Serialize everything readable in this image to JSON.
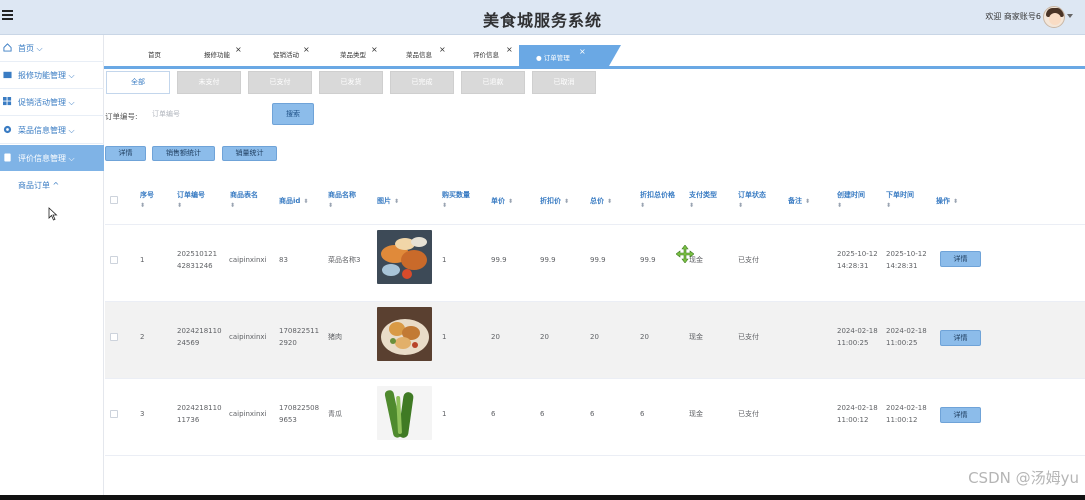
{
  "app": {
    "title": "美食城服务系统",
    "welcome": "欢迎 商家账号6"
  },
  "sidebar": {
    "items": [
      {
        "label": "首页",
        "icon": "home-icon"
      },
      {
        "label": "报修功能管理",
        "icon": "folder-icon"
      },
      {
        "label": "促销活动管理",
        "icon": "grid-icon"
      },
      {
        "label": "菜品信息管理",
        "icon": "gear-icon"
      },
      {
        "label": "评价信息管理",
        "icon": "doc-icon"
      }
    ],
    "sub_item": "商品订单",
    "active_index": 4
  },
  "tabs": {
    "items": [
      "首页",
      "报修功能",
      "促销活动",
      "菜品类型",
      "菜品信息",
      "评价信息"
    ],
    "active": "订单管理"
  },
  "status_tabs": [
    "全部",
    "未支付",
    "已支付",
    "已发货",
    "已完成",
    "已退款",
    "已取消"
  ],
  "search": {
    "label": "订单编号:",
    "placeholder": "订单编号",
    "button": "搜索"
  },
  "toolbar": {
    "detail": "详情",
    "sales_amount": "销售额统计",
    "sales_volume": "销量统计"
  },
  "table": {
    "headers": {
      "index": "序号",
      "order_no": "订单编号",
      "table_name": "商品表名",
      "goods_id": "商品id",
      "goods_name": "商品名称",
      "image": "图片",
      "qty": "购买数量",
      "price": "单价",
      "discount_price": "折扣价",
      "total": "总价",
      "discount_total": "折扣总价格",
      "pay_type": "支付类型",
      "status": "订单状态",
      "remark": "备注",
      "created": "创建时间",
      "ordered": "下单时间",
      "action": "操作"
    },
    "rows": [
      {
        "index": "1",
        "order_no_a": "202510121",
        "order_no_b": "42831246",
        "table_name": "caipinxinxi",
        "goods_id_a": "83",
        "goods_id_b": "",
        "goods_name": "菜品名称3",
        "qty": "1",
        "price": "99.9",
        "discount_price": "99.9",
        "total": "99.9",
        "discount_total": "99.9",
        "pay_type": "现金",
        "status": "已支付",
        "remark": "",
        "created_date": "2025-10-12",
        "created_time": "14:28:31",
        "ordered_date": "2025-10-12",
        "ordered_time": "14:28:31",
        "action": "详情"
      },
      {
        "index": "2",
        "order_no_a": "2024218110",
        "order_no_b": "24569",
        "table_name": "caipinxinxi",
        "goods_id_a": "170822511",
        "goods_id_b": "2920",
        "goods_name": "猪肉",
        "qty": "1",
        "price": "20",
        "discount_price": "20",
        "total": "20",
        "discount_total": "20",
        "pay_type": "现金",
        "status": "已支付",
        "remark": "",
        "created_date": "2024-02-18",
        "created_time": "11:00:25",
        "ordered_date": "2024-02-18",
        "ordered_time": "11:00:25",
        "action": "详情"
      },
      {
        "index": "3",
        "order_no_a": "2024218110",
        "order_no_b": "11736",
        "table_name": "caipinxinxi",
        "goods_id_a": "170822508",
        "goods_id_b": "9653",
        "goods_name": "青瓜",
        "qty": "1",
        "price": "6",
        "discount_price": "6",
        "total": "6",
        "discount_total": "6",
        "pay_type": "现金",
        "status": "已支付",
        "remark": "",
        "created_date": "2024-02-18",
        "created_time": "11:00:12",
        "ordered_date": "2024-02-18",
        "ordered_time": "11:00:12",
        "action": "详情"
      }
    ]
  },
  "watermark": "CSDN @汤姆yu",
  "colors": {
    "accent": "#6aa8e4",
    "button": "#8cbcea",
    "header_bg": "#dde7f3",
    "link": "#3a7cc3"
  }
}
